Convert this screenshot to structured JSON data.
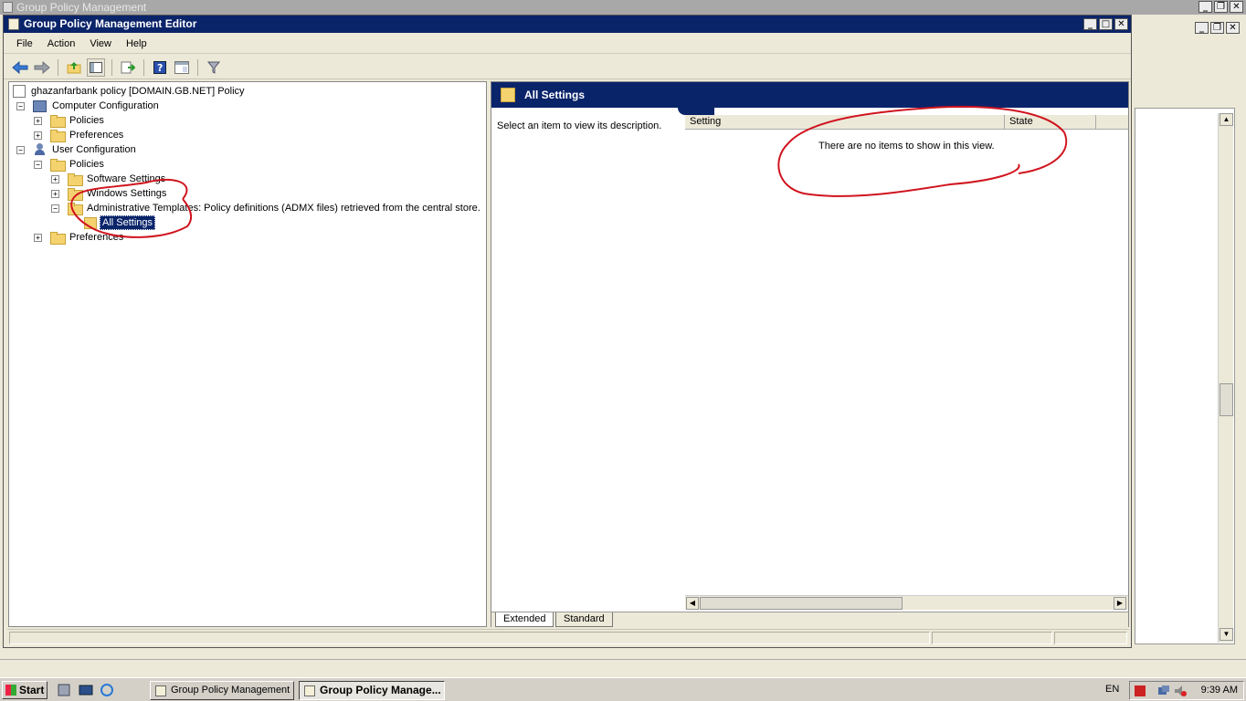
{
  "background_window": {
    "title": "Group Policy Management"
  },
  "editor": {
    "title": "Group Policy Management Editor",
    "menu": [
      "File",
      "Action",
      "View",
      "Help"
    ],
    "toolbar_icons": [
      "back-icon",
      "forward-icon",
      "up-folder-icon",
      "show-hide-tree-icon",
      "export-list-icon",
      "help-icon",
      "properties-icon",
      "filter-icon"
    ]
  },
  "tree": {
    "root": "ghazanfarbank policy [DOMAIN.GB.NET] Policy",
    "computer_config": "Computer Configuration",
    "cc_policies": "Policies",
    "cc_preferences": "Preferences",
    "user_config": "User Configuration",
    "uc_policies": "Policies",
    "software_settings": "Software Settings",
    "windows_settings": "Windows Settings",
    "admin_templates": "Administrative Templates: Policy definitions (ADMX files) retrieved from the central store.",
    "all_settings": "All Settings",
    "uc_preferences": "Preferences"
  },
  "right_pane": {
    "title": "All Settings",
    "description": "Select an item to view its description.",
    "columns": [
      "Setting",
      "State"
    ],
    "empty_message": "There are no items to show in this view.",
    "tabs": [
      "Extended",
      "Standard"
    ]
  },
  "taskbar": {
    "start": "Start",
    "buttons": [
      "Group Policy Management",
      "Group Policy Manage..."
    ],
    "language": "EN",
    "time": "9:39 AM"
  },
  "colors": {
    "title_active": "#0a246a",
    "annotation": "#d0141e"
  }
}
